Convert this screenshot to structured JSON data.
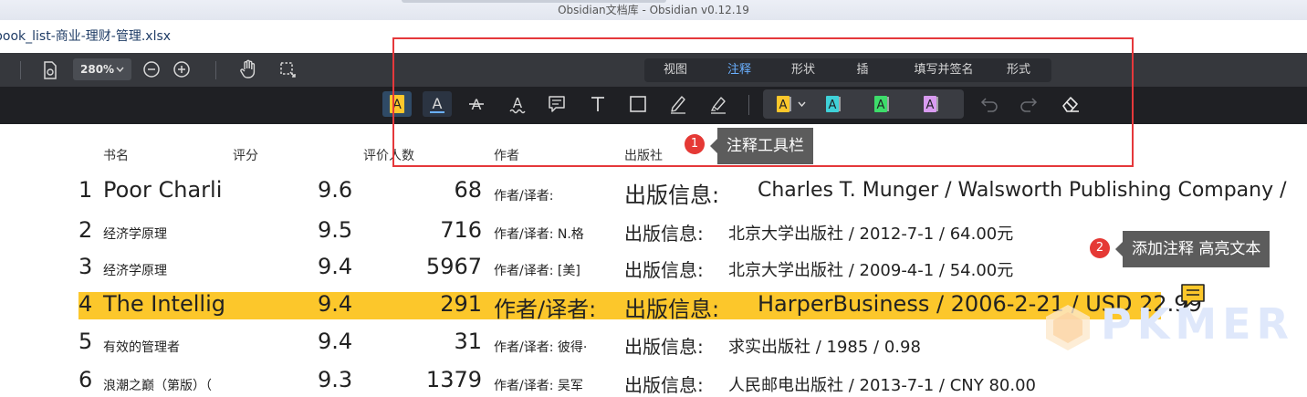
{
  "window": {
    "title": "Obsidian文档库 - Obsidian v0.12.19"
  },
  "file": {
    "name": "book_list-商业-理财-管理.xlsx"
  },
  "toolbar": {
    "zoom": "280%"
  },
  "tabs": [
    {
      "label": "视图",
      "active": false
    },
    {
      "label": "注释",
      "active": true
    },
    {
      "label": "形状",
      "active": false
    },
    {
      "label": "插",
      "active": false
    },
    {
      "label": "填写并签名",
      "active": false
    },
    {
      "label": "形式",
      "active": false
    }
  ],
  "annotation_tools": [
    "highlight-text-icon",
    "underline-text-icon",
    "strikethrough-text-icon",
    "squiggly-text-icon",
    "comment-icon",
    "text-box-icon",
    "rectangle-icon",
    "pen-icon",
    "highlighter-pen-icon"
  ],
  "highlight_colors": [
    "#fcc72b",
    "#3fd1d8",
    "#3ddc6a",
    "#d89bf0"
  ],
  "callouts": [
    {
      "badge": "1",
      "text": "注释工具栏"
    },
    {
      "badge": "2",
      "text": "添加注释 高亮文本"
    }
  ],
  "table": {
    "headers": [
      "书名",
      "评分",
      "评价人数",
      "作者",
      "出版社"
    ],
    "rows": [
      {
        "rank": "1",
        "title": "Poor Charli",
        "score": "9.6",
        "count": "68",
        "author": "作者/译者:",
        "pub_label": "出版信息:",
        "pub": "Charles T. Munger / Walsworth Publishing Company /"
      },
      {
        "rank": "2",
        "title": "经济学原理",
        "score": "9.5",
        "count": "716",
        "author": "作者/译者: N.格",
        "pub_label": "出版信息:",
        "pub": "北京大学出版社 / 2012-7-1 / 64.00元"
      },
      {
        "rank": "3",
        "title": "经济学原理",
        "score": "9.4",
        "count": "5967",
        "author": "作者/译者: [美]",
        "pub_label": "出版信息:",
        "pub": "北京大学出版社 / 2009-4-1 / 54.00元"
      },
      {
        "rank": "4",
        "title": "The Intellig",
        "score": "9.4",
        "count": "291",
        "author": "作者/译者:",
        "pub_label": "出版信息:",
        "pub": "HarperBusiness / 2006-2-21 / USD 22.99"
      },
      {
        "rank": "5",
        "title": "有效的管理者",
        "score": "9.4",
        "count": "31",
        "author": "作者/译者: 彼得·",
        "pub_label": "出版信息:",
        "pub": "求实出版社 / 1985 / 0.98"
      },
      {
        "rank": "6",
        "title": "浪潮之巅（第版）（",
        "score": "9.3",
        "count": "1379",
        "author": "作者/译者: 吴军",
        "pub_label": "出版信息:",
        "pub": "人民邮电出版社 / 2013-7-1 / CNY 80.00"
      }
    ]
  },
  "watermark": "PKMER",
  "colors": {
    "accent": "#6ab0ff",
    "highlight": "#fcc72b",
    "frame": "#e5383b"
  }
}
